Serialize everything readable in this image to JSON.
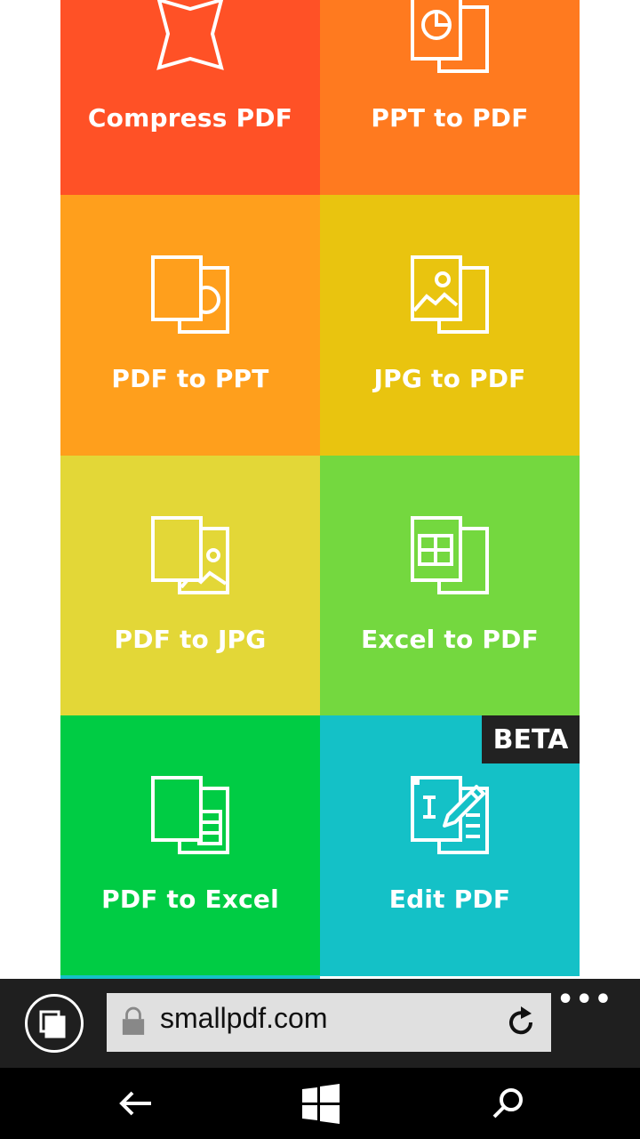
{
  "tiles": [
    {
      "name": "compress-pdf",
      "label": "Compress PDF",
      "color": "#FF5126",
      "icon": "compress-icon"
    },
    {
      "name": "ppt-to-pdf",
      "label": "PPT to PDF",
      "color": "#FF7A1F",
      "icon": "ppt-to-pdf-icon"
    },
    {
      "name": "pdf-to-ppt",
      "label": "PDF to PPT",
      "color": "#FF9F1C",
      "icon": "pdf-to-ppt-icon"
    },
    {
      "name": "jpg-to-pdf",
      "label": "JPG to PDF",
      "color": "#E9C40F",
      "icon": "jpg-to-pdf-icon"
    },
    {
      "name": "pdf-to-jpg",
      "label": "PDF to JPG",
      "color": "#E3D737",
      "icon": "pdf-to-jpg-icon"
    },
    {
      "name": "excel-to-pdf",
      "label": "Excel to PDF",
      "color": "#74D83F",
      "icon": "excel-to-pdf-icon"
    },
    {
      "name": "pdf-to-excel",
      "label": "PDF to Excel",
      "color": "#00CC44",
      "icon": "pdf-to-excel-icon"
    },
    {
      "name": "edit-pdf",
      "label": "Edit PDF",
      "color": "#14C1C7",
      "icon": "edit-pdf-icon",
      "badge": "BETA"
    }
  ],
  "browser": {
    "url": "smallpdf.com",
    "more_label": "•••"
  }
}
